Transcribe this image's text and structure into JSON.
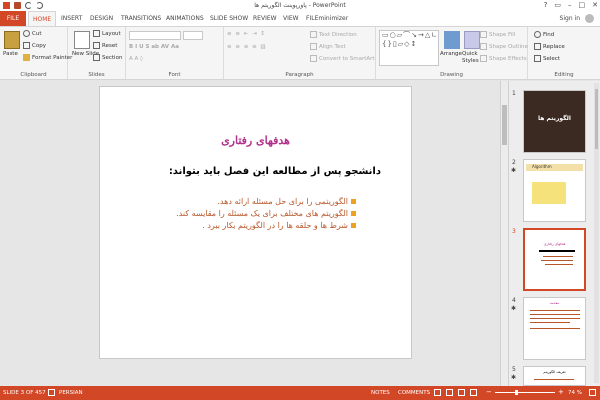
{
  "window": {
    "title": "پاورپوینت الگوریتم ها - PowerPoint",
    "controls": [
      "?",
      "▭",
      "–",
      "□",
      "✕"
    ],
    "sign_in": "Sign in"
  },
  "tabs": [
    "FILE",
    "HOME",
    "INSERT",
    "DESIGN",
    "TRANSITIONS",
    "ANIMATIONS",
    "SLIDE SHOW",
    "REVIEW",
    "VIEW",
    "FILEminimizer"
  ],
  "ribbon": {
    "clipboard": {
      "paste": "Paste",
      "cut": "Cut",
      "copy": "Copy",
      "format_painter": "Format Painter",
      "label": "Clipboard"
    },
    "slides": {
      "new_slide": "New Slide",
      "layout": "Layout",
      "reset": "Reset",
      "section": "Section",
      "label": "Slides"
    },
    "font": {
      "label": "Font"
    },
    "paragraph": {
      "text_direction": "Text Direction",
      "align_text": "Align Text",
      "smartart": "Convert to SmartArt",
      "label": "Paragraph"
    },
    "drawing": {
      "arrange": "Arrange",
      "quick_styles": "Quick Styles",
      "shape_fill": "Shape Fill",
      "shape_outline": "Shape Outline",
      "shape_effects": "Shape Effects",
      "label": "Drawing"
    },
    "editing": {
      "find": "Find",
      "replace": "Replace",
      "select": "Select",
      "label": "Editing"
    }
  },
  "slide": {
    "title": "هدفهای رفتاری",
    "subtitle": "دانشجو پس از مطالعه این فصل باید بتواند:",
    "bullets": [
      "الگوریتمی را برای حل مسئله ارائه دهد.",
      "الگوریتم های مختلف برای یک مسئله را مقایسه کند.",
      "شرط ها و حلقه ها را در الگوریتم بکار ببرد ."
    ]
  },
  "thumbnails": [
    {
      "num": "1",
      "label": "الگوریتم ها"
    },
    {
      "num": "2",
      "label": "Algorithm"
    },
    {
      "num": "3",
      "label": "هدفهای رفتاری"
    },
    {
      "num": "4",
      "label": "مقدمه"
    },
    {
      "num": "5",
      "label": "تعریف الگوریتم"
    }
  ],
  "status": {
    "slide_info": "SLIDE 3 OF 457",
    "language": "PERSIAN",
    "notes": "NOTES",
    "comments": "COMMENTS",
    "zoom": "74 %"
  },
  "colors": {
    "accent": "#d24726",
    "title": "#b0308a",
    "bullet_text": "#b9562a",
    "bullet_marker": "#f0a020"
  }
}
